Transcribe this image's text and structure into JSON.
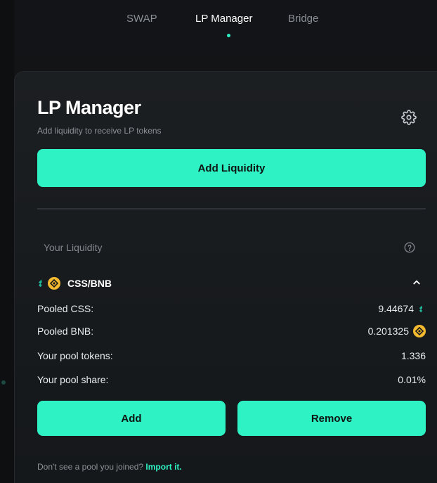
{
  "nav": {
    "tabs": [
      {
        "label": "SWAP",
        "active": false
      },
      {
        "label": "LP Manager",
        "active": true
      },
      {
        "label": "Bridge",
        "active": false
      }
    ]
  },
  "card": {
    "title": "LP Manager",
    "subtitle": "Add liquidity to receive LP tokens",
    "add_liquidity_label": "Add Liquidity",
    "your_liquidity_label": "Your Liquidity",
    "pair": "CSS/BNB",
    "rows": [
      {
        "label": "Pooled CSS:",
        "value": "9.44674",
        "icon": "css-token-icon"
      },
      {
        "label": "Pooled BNB:",
        "value": "0.201325",
        "icon": "bnb-token-icon"
      },
      {
        "label": "Your pool tokens:",
        "value": "1.336"
      },
      {
        "label": "Your pool share:",
        "value": "0.01%"
      }
    ],
    "add_label": "Add",
    "remove_label": "Remove",
    "footer_text": "Don't see a pool you joined?",
    "footer_link": "Import it."
  },
  "colors": {
    "accent": "#2ef2c3",
    "bnb": "#f3ba2f",
    "css": "#1fb89a",
    "background": "#101215",
    "card": "#1c1f22"
  }
}
